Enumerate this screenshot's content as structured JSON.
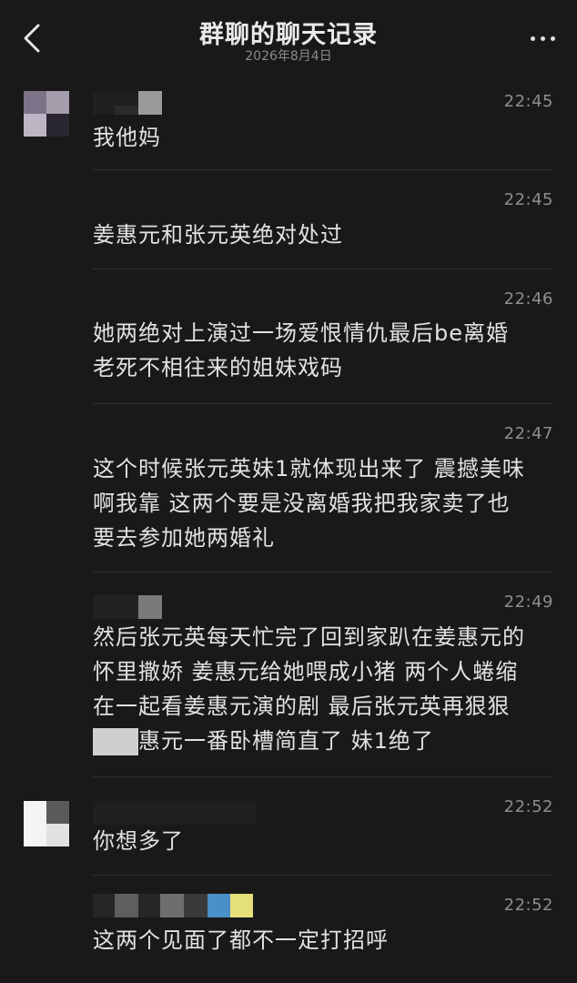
{
  "header": {
    "title": "群聊的聊天记录",
    "date": "2026年8月4日"
  },
  "messages": [
    {
      "time": "22:45",
      "text": "我他妈"
    },
    {
      "time": "22:45",
      "text": "姜惠元和张元英绝对处过"
    },
    {
      "time": "22:46",
      "text": "她两绝对上演过一场爱恨情仇最后be离婚\n老死不相往来的姐妹戏码"
    },
    {
      "time": "22:47",
      "text": "这个时候张元英妹1就体现出来了 震撼美味\n啊我靠 这两个要是没离婚我把我家卖了也\n要去参加她两婚礼"
    },
    {
      "time": "22:49",
      "text": "然后张元英每天忙完了回到家趴在姜惠元的\n怀里撒娇 姜惠元给她喂成小猪 两个人蜷缩\n在一起看姜惠元演的剧 最后张元英再狠狠\n上姜惠元一番卧槽简直了 妹1绝了"
    },
    {
      "time": "22:52",
      "text": "你想多了"
    },
    {
      "time": "22:52",
      "text": "这两个见面了都不一定打招呼"
    }
  ],
  "icons": {
    "back": "chevron-left-icon",
    "more": "more-dots-icon"
  },
  "colors": {
    "background": "#191919",
    "text": "#e2e2e2",
    "time": "#8e8e8e",
    "divider": "#2e2e2e"
  }
}
